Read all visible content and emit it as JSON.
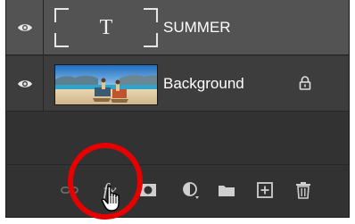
{
  "layers": [
    {
      "name": "SUMMER",
      "thumbnail": "T",
      "kind": "type-layer",
      "visible": true,
      "selected": true,
      "locked": false
    },
    {
      "name": "Background",
      "kind": "image-layer",
      "visible": true,
      "selected": false,
      "locked": true
    }
  ],
  "toolbar": {
    "buttons": [
      {
        "id": "link-layers",
        "icon": "link-icon"
      },
      {
        "id": "add-layer-style",
        "icon": "fx-icon",
        "label": "fx"
      },
      {
        "id": "add-layer-mask",
        "icon": "mask-icon"
      },
      {
        "id": "new-adjustment-layer",
        "icon": "adjustment-icon"
      },
      {
        "id": "new-group",
        "icon": "folder-icon"
      },
      {
        "id": "new-layer",
        "icon": "new-layer-icon"
      },
      {
        "id": "delete-layer",
        "icon": "trash-icon"
      }
    ]
  },
  "annotation": {
    "shape": "circle",
    "color": "#e60000",
    "target": "add-layer-style"
  },
  "colors": {
    "panel_bg": "#323232",
    "selected_row": "#535353",
    "row_bg": "#3d3d3d",
    "text": "#ffffff",
    "icon": "#cfcfcf",
    "highlight": "#e60000"
  }
}
